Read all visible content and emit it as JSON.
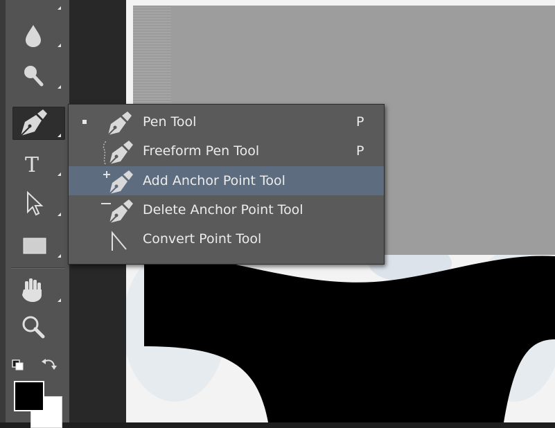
{
  "toolbar": {
    "tools": [
      {
        "name": "blur-tool",
        "icon": "drop-icon"
      },
      {
        "name": "dodge-tool",
        "icon": "dodge-icon"
      },
      {
        "name": "pen-tool",
        "icon": "pen-icon",
        "active": true
      },
      {
        "name": "type-tool",
        "icon": "type-icon",
        "glyph": "T"
      },
      {
        "name": "path-selection-tool",
        "icon": "arrow-icon"
      },
      {
        "name": "rectangle-tool",
        "icon": "rectangle-icon"
      },
      {
        "name": "hand-tool",
        "icon": "hand-icon"
      },
      {
        "name": "zoom-tool",
        "icon": "zoom-icon"
      }
    ],
    "colors": {
      "foreground": "#000000",
      "background": "#ffffff"
    }
  },
  "flyout": {
    "items": [
      {
        "label": "Pen Tool",
        "shortcut": "P",
        "selected": true,
        "icon": "pen-icon"
      },
      {
        "label": "Freeform Pen Tool",
        "shortcut": "P",
        "icon": "freeform-pen-icon"
      },
      {
        "label": "Add Anchor Point Tool",
        "shortcut": "",
        "hovered": true,
        "icon": "add-anchor-icon"
      },
      {
        "label": "Delete Anchor Point Tool",
        "shortcut": "",
        "icon": "delete-anchor-icon"
      },
      {
        "label": "Convert Point Tool",
        "shortcut": "",
        "icon": "convert-point-icon"
      }
    ],
    "hover_color": "#5d6c7f",
    "menu_color": "#5a5a5a"
  },
  "canvas": {
    "gray_color": "#9d9d9d",
    "shape_color": "#000000"
  }
}
